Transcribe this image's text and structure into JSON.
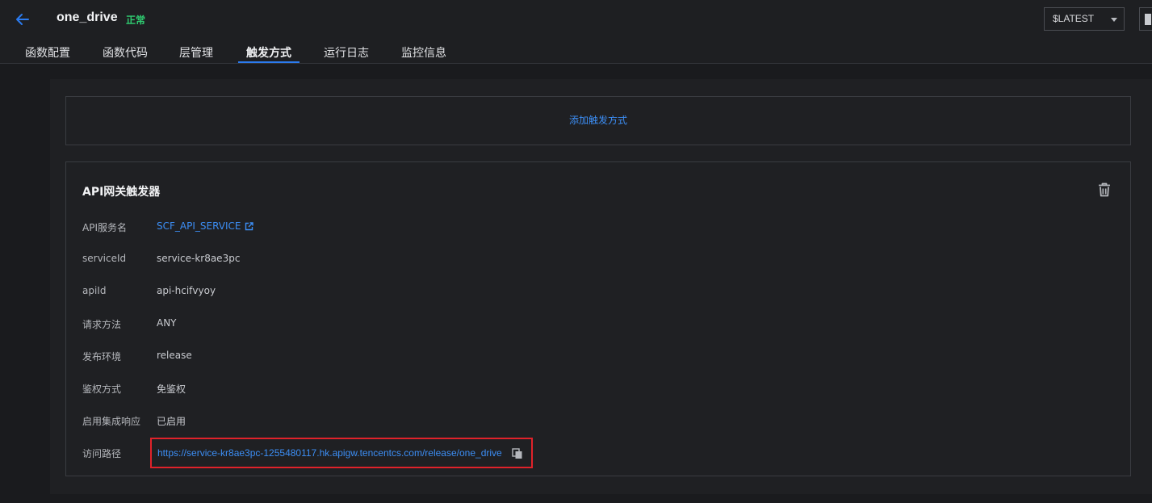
{
  "header": {
    "function_name": "one_drive",
    "status": "正常",
    "version": "$LATEST"
  },
  "tabs": [
    {
      "label": "函数配置"
    },
    {
      "label": "函数代码"
    },
    {
      "label": "层管理"
    },
    {
      "label": "触发方式",
      "active": true
    },
    {
      "label": "运行日志"
    },
    {
      "label": "监控信息"
    }
  ],
  "add_trigger": {
    "label": "添加触发方式"
  },
  "trigger": {
    "title": "API网关触发器",
    "rows": [
      {
        "label": "API服务名",
        "value": "SCF_API_SERVICE"
      },
      {
        "label": "serviceId",
        "value": "service-kr8ae3pc"
      },
      {
        "label": "apiId",
        "value": "api-hcifvyoy"
      },
      {
        "label": "请求方法",
        "value": "ANY"
      },
      {
        "label": "发布环境",
        "value": "release"
      },
      {
        "label": "鉴权方式",
        "value": "免鉴权"
      },
      {
        "label": "启用集成响应",
        "value": "已启用"
      },
      {
        "label": "访问路径",
        "value": "https://service-kr8ae3pc-1255480117.hk.apigw.tencentcs.com/release/one_drive"
      }
    ]
  },
  "colors": {
    "accent": "#2b7bf0",
    "link": "#3c8ef5",
    "status_ok": "#2fcc71",
    "highlight": "#e0222a"
  },
  "icons": [
    "arrow-left-icon",
    "caret-down-icon",
    "trash-icon",
    "external-link-icon",
    "copy-icon"
  ]
}
